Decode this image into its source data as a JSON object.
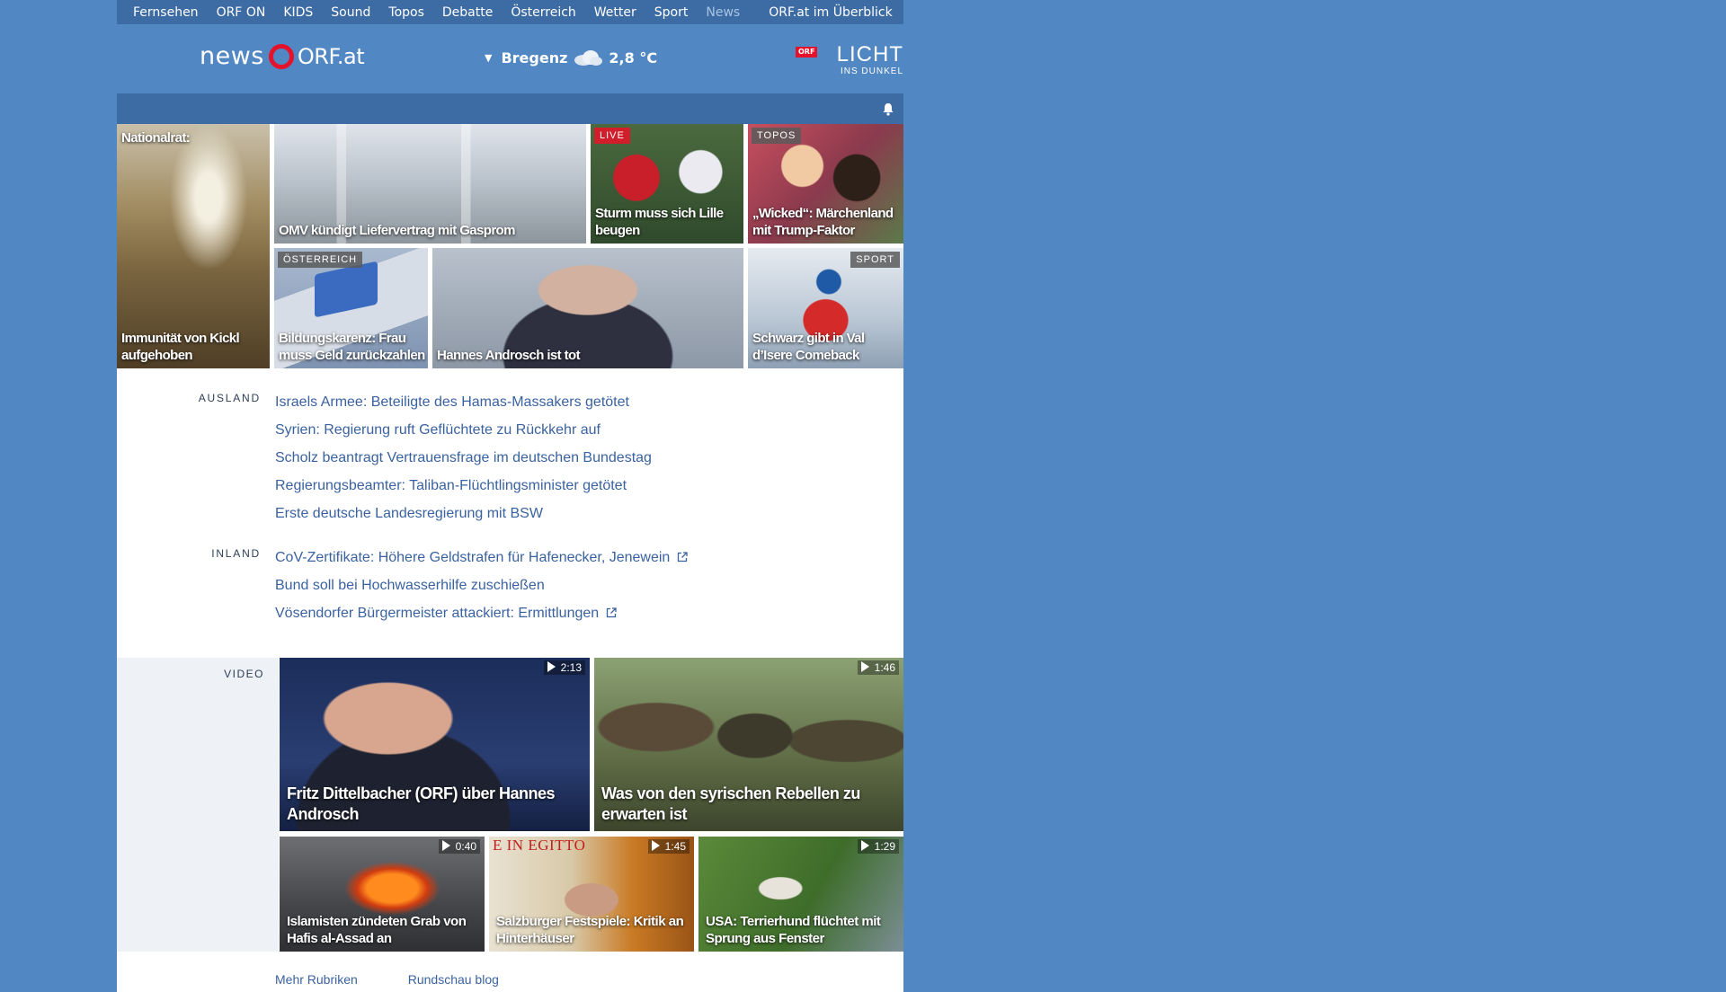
{
  "topnav": {
    "items": [
      "Fernsehen",
      "ORF ON",
      "KIDS",
      "Sound",
      "Topos",
      "Debatte",
      "Österreich",
      "Wetter",
      "Sport",
      "News"
    ],
    "active": "News",
    "overview": "ORF.at im Überblick"
  },
  "header": {
    "logo_news": "news",
    "logo_orf": "ORF.at",
    "weather": {
      "city": "Bregenz",
      "temp": "2,8 °C",
      "icon": "cloud-icon"
    },
    "light": {
      "badge": "ORF",
      "word": "LICHT",
      "sub": "INS DUNKEL"
    }
  },
  "tiles": [
    {
      "title": "Nationalrat:",
      "title2": "Immunität von Kickl aufgehoben"
    },
    {
      "title": "OMV kündigt Liefervertrag mit Gasprom"
    },
    {
      "badge": "LIVE",
      "title": "Sturm muss sich Lille beugen"
    },
    {
      "badge": "TOPOS",
      "title": "„Wicked“: Märchenland mit Trump-Faktor"
    },
    {
      "badge": "ÖSTERREICH",
      "title": "Bildungskarenz: Frau muss Geld zurückzahlen"
    },
    {
      "title": "Hannes Androsch ist tot"
    },
    {
      "badge": "SPORT",
      "title": "Schwarz gibt in Val d’Isere Comeback"
    }
  ],
  "sections": [
    {
      "label": "AUSLAND",
      "items": [
        "Israels Armee: Beteiligte des Hamas-Massakers getötet",
        "Syrien: Regierung ruft Geflüchtete zu Rückkehr auf",
        "Scholz beantragt Vertrauensfrage im deutschen Bundestag",
        "Regierungsbeamter: Taliban-Flüchtlingsminister getötet",
        "Erste deutsche Landesregierung mit BSW"
      ]
    },
    {
      "label": "INLAND",
      "items": [
        "CoV-Zertifikate: Höhere Geldstrafen für Hafenecker, Jenewein",
        "Bund soll bei Hochwasserhilfe zuschießen",
        "Vösendorfer Bürgermeister attackiert: Ermittlungen"
      ],
      "external": [
        true,
        false,
        true
      ]
    }
  ],
  "video": {
    "label": "VIDEO",
    "items": [
      {
        "duration": "2:13",
        "title": "Fritz Dittelbacher (ORF) über Hannes Androsch"
      },
      {
        "duration": "1:46",
        "title": "Was von den syrischen Rebellen zu erwarten ist"
      },
      {
        "duration": "0:40",
        "title": "Islamisten zündeten Grab von Hafis al-Assad an"
      },
      {
        "duration": "1:45",
        "title": "Salzburger Festspiele: Kritik an Hinterhäuser",
        "overlay": "E IN EGITTO"
      },
      {
        "duration": "1:29",
        "title": "USA: Terrierhund flüchtet mit Sprung aus Fenster"
      }
    ]
  },
  "more": {
    "links": [
      "Mehr Rubriken",
      "Rundschau blog"
    ]
  }
}
